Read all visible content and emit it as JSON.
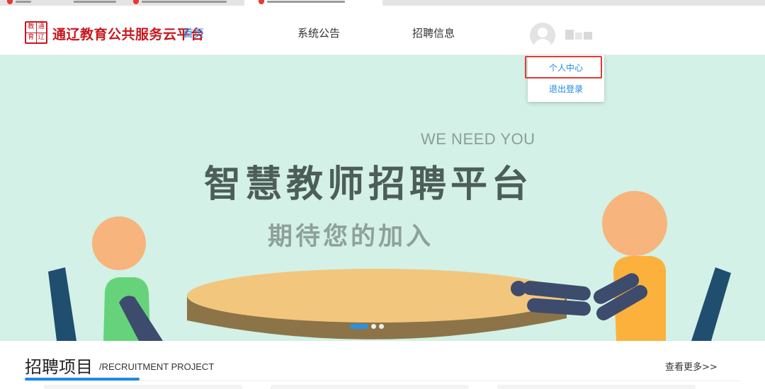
{
  "browser": {
    "tabs": [
      {
        "fav_color": "#e53935"
      },
      {
        "fav_color": "#f0f0f0"
      },
      {
        "fav_color": "#e53935"
      },
      {
        "fav_color": "#e53935"
      }
    ]
  },
  "header": {
    "logo_seal": [
      "教",
      "通",
      "育",
      "辽"
    ],
    "logo_text": "通辽教育公共服务云平台",
    "nav": [
      {
        "label": "首页",
        "active": true
      },
      {
        "label": "系统公告",
        "active": false
      },
      {
        "label": "招聘信息",
        "active": false
      }
    ]
  },
  "user_menu": {
    "items": [
      "个人中心",
      "退出登录"
    ],
    "highlighted_index": 0
  },
  "banner": {
    "tagline": "WE NEED YOU",
    "title": "智慧教师招聘平台",
    "subtitle": "期待您的加入",
    "carousel": {
      "slides": 3,
      "active_index": 0
    }
  },
  "section": {
    "title": "招聘项目",
    "subtitle": "/RECRUITMENT PROJECT",
    "more_link": "查看更多>>"
  },
  "colors": {
    "brand_red": "#c8161d",
    "accent_blue": "#1e88e5",
    "banner_bg": "#d3f1e6",
    "highlight_red": "#e53935"
  }
}
